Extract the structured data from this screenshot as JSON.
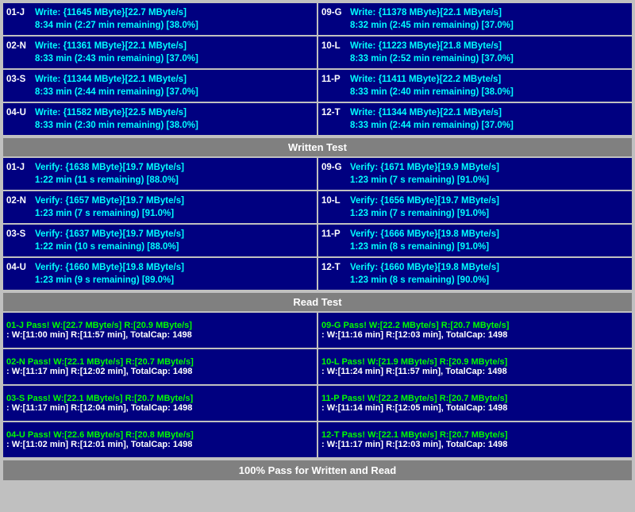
{
  "sections": {
    "write": {
      "cells_left": [
        {
          "id": "01-J",
          "line1": "Write: {11645 MByte}[22.7 MByte/s]",
          "line2": "8:34 min (2:27 min remaining)  [38.0%]"
        },
        {
          "id": "02-N",
          "line1": "Write: {11361 MByte}[22.1 MByte/s]",
          "line2": "8:33 min (2:43 min remaining)  [37.0%]"
        },
        {
          "id": "03-S",
          "line1": "Write: {11344 MByte}[22.1 MByte/s]",
          "line2": "8:33 min (2:44 min remaining)  [37.0%]"
        },
        {
          "id": "04-U",
          "line1": "Write: {11582 MByte}[22.5 MByte/s]",
          "line2": "8:33 min (2:30 min remaining)  [38.0%]"
        }
      ],
      "cells_right": [
        {
          "id": "09-G",
          "line1": "Write: {11378 MByte}[22.1 MByte/s]",
          "line2": "8:32 min (2:45 min remaining)  [37.0%]"
        },
        {
          "id": "10-L",
          "line1": "Write: {11223 MByte}[21.8 MByte/s]",
          "line2": "8:33 min (2:52 min remaining)  [37.0%]"
        },
        {
          "id": "11-P",
          "line1": "Write: {11411 MByte}[22.2 MByte/s]",
          "line2": "8:33 min (2:40 min remaining)  [38.0%]"
        },
        {
          "id": "12-T",
          "line1": "Write: {11344 MByte}[22.1 MByte/s]",
          "line2": "8:33 min (2:44 min remaining)  [37.0%]"
        }
      ],
      "header": "Written Test"
    },
    "verify": {
      "cells_left": [
        {
          "id": "01-J",
          "line1": "Verify: {1638 MByte}[19.7 MByte/s]",
          "line2": "1:22 min (11 s remaining)  [88.0%]"
        },
        {
          "id": "02-N",
          "line1": "Verify: {1657 MByte}[19.7 MByte/s]",
          "line2": "1:23 min (7 s remaining)  [91.0%]"
        },
        {
          "id": "03-S",
          "line1": "Verify: {1637 MByte}[19.7 MByte/s]",
          "line2": "1:22 min (10 s remaining)  [88.0%]"
        },
        {
          "id": "04-U",
          "line1": "Verify: {1660 MByte}[19.8 MByte/s]",
          "line2": "1:23 min (9 s remaining)  [89.0%]"
        }
      ],
      "cells_right": [
        {
          "id": "09-G",
          "line1": "Verify: {1671 MByte}[19.9 MByte/s]",
          "line2": "1:23 min (7 s remaining)  [91.0%]"
        },
        {
          "id": "10-L",
          "line1": "Verify: {1656 MByte}[19.7 MByte/s]",
          "line2": "1:23 min (7 s remaining)  [91.0%]"
        },
        {
          "id": "11-P",
          "line1": "Verify: {1666 MByte}[19.8 MByte/s]",
          "line2": "1:23 min (8 s remaining)  [91.0%]"
        },
        {
          "id": "12-T",
          "line1": "Verify: {1660 MByte}[19.8 MByte/s]",
          "line2": "1:23 min (8 s remaining)  [90.0%]"
        }
      ],
      "header": "Read Test"
    },
    "read": {
      "cells_left": [
        {
          "id": "01-J",
          "line1": "Pass! W:[22.7 MByte/s] R:[20.9 MByte/s]",
          "line2": ": W:[11:00 min] R:[11:57 min], TotalCap: 1498"
        },
        {
          "id": "02-N",
          "line1": "Pass! W:[22.1 MByte/s] R:[20.7 MByte/s]",
          "line2": ": W:[11:17 min] R:[12:02 min], TotalCap: 1498"
        },
        {
          "id": "03-S",
          "line1": "Pass! W:[22.1 MByte/s] R:[20.7 MByte/s]",
          "line2": ": W:[11:17 min] R:[12:04 min], TotalCap: 1498"
        },
        {
          "id": "04-U",
          "line1": "Pass! W:[22.6 MByte/s] R:[20.8 MByte/s]",
          "line2": ": W:[11:02 min] R:[12:01 min], TotalCap: 1498"
        }
      ],
      "cells_right": [
        {
          "id": "09-G",
          "line1": "Pass! W:[22.2 MByte/s] R:[20.7 MByte/s]",
          "line2": ": W:[11:16 min] R:[12:03 min], TotalCap: 1498"
        },
        {
          "id": "10-L",
          "line1": "Pass! W:[21.9 MByte/s] R:[20.9 MByte/s]",
          "line2": ": W:[11:24 min] R:[11:57 min], TotalCap: 1498"
        },
        {
          "id": "11-P",
          "line1": "Pass! W:[22.2 MByte/s] R:[20.7 MByte/s]",
          "line2": ": W:[11:14 min] R:[12:05 min], TotalCap: 1498"
        },
        {
          "id": "12-T",
          "line1": "Pass! W:[22.1 MByte/s] R:[20.7 MByte/s]",
          "line2": ": W:[11:17 min] R:[12:03 min], TotalCap: 1498"
        }
      ]
    },
    "footer": "100% Pass for Written and Read"
  }
}
